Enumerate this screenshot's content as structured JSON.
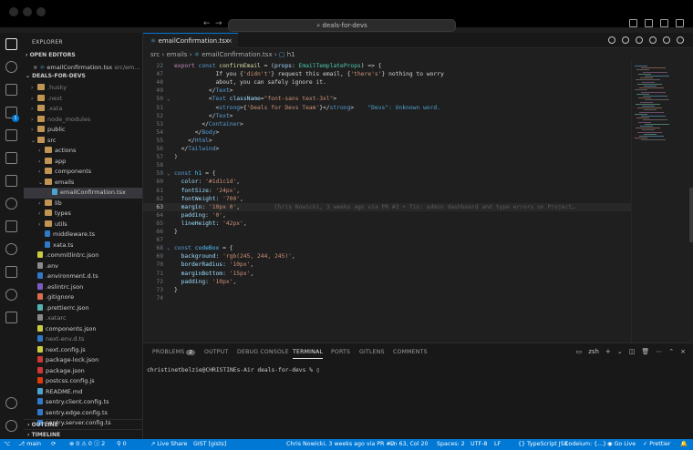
{
  "titlebar": {
    "search": "deals-for-devs"
  },
  "sidebar": {
    "title": "EXPLORER",
    "open_editors_label": "OPEN EDITORS",
    "open_editor_file": "emailConfirmation.tsx",
    "open_editor_path": "src/em...",
    "project_label": "DEALS-FOR-DEVS",
    "tree": [
      {
        "label": ".husky",
        "depth": 1,
        "chev": "›",
        "color": "#7d7d7d",
        "kind": "folder"
      },
      {
        "label": ".next",
        "depth": 1,
        "chev": "›",
        "color": "#7d7d7d",
        "kind": "folder"
      },
      {
        "label": ".xata",
        "depth": 1,
        "chev": "›",
        "color": "#7d7d7d",
        "kind": "folder"
      },
      {
        "label": "node_modules",
        "depth": 1,
        "chev": "›",
        "color": "#7d7d7d",
        "kind": "folder"
      },
      {
        "label": "public",
        "depth": 1,
        "chev": "›",
        "color": "#cccccc",
        "kind": "folder"
      },
      {
        "label": "src",
        "depth": 1,
        "chev": "⌄",
        "color": "#cccccc",
        "kind": "folder"
      },
      {
        "label": "actions",
        "depth": 2,
        "chev": "›",
        "color": "#cccccc",
        "kind": "folder"
      },
      {
        "label": "app",
        "depth": 2,
        "chev": "›",
        "color": "#cccccc",
        "kind": "folder"
      },
      {
        "label": "components",
        "depth": 2,
        "chev": "›",
        "color": "#cccccc",
        "kind": "folder"
      },
      {
        "label": "emails",
        "depth": 2,
        "chev": "⌄",
        "color": "#cccccc",
        "kind": "folder"
      },
      {
        "label": "emailConfirmation.tsx",
        "depth": 3,
        "chev": "",
        "color": "#cccccc",
        "kind": "tsx",
        "selected": true
      },
      {
        "label": "lib",
        "depth": 2,
        "chev": "›",
        "color": "#cccccc",
        "kind": "folder"
      },
      {
        "label": "types",
        "depth": 2,
        "chev": "›",
        "color": "#cccccc",
        "kind": "folder"
      },
      {
        "label": "utils",
        "depth": 2,
        "chev": "›",
        "color": "#cccccc",
        "kind": "folder"
      },
      {
        "label": "middleware.ts",
        "depth": 2,
        "chev": "",
        "color": "#cccccc",
        "kind": "ts"
      },
      {
        "label": "xata.ts",
        "depth": 2,
        "chev": "",
        "color": "#cccccc",
        "kind": "ts"
      },
      {
        "label": ".commitlintrc.json",
        "depth": 1,
        "chev": "",
        "color": "#cccccc",
        "kind": "json"
      },
      {
        "label": ".env",
        "depth": 1,
        "chev": "",
        "color": "#cccccc",
        "kind": "gear"
      },
      {
        "label": ".environment.d.ts",
        "depth": 1,
        "chev": "",
        "color": "#cccccc",
        "kind": "ts"
      },
      {
        "label": ".eslintrc.json",
        "depth": 1,
        "chev": "",
        "color": "#cccccc",
        "kind": "eslint"
      },
      {
        "label": ".gitignore",
        "depth": 1,
        "chev": "",
        "color": "#cccccc",
        "kind": "git"
      },
      {
        "label": ".prettierrc.json",
        "depth": 1,
        "chev": "",
        "color": "#cccccc",
        "kind": "prettier"
      },
      {
        "label": ".xatarc",
        "depth": 1,
        "chev": "",
        "color": "#8a8a8a",
        "kind": "plain"
      },
      {
        "label": "components.json",
        "depth": 1,
        "chev": "",
        "color": "#cccccc",
        "kind": "json"
      },
      {
        "label": "next-env.d.ts",
        "depth": 1,
        "chev": "",
        "color": "#8a8a8a",
        "kind": "ts"
      },
      {
        "label": "next.config.js",
        "depth": 1,
        "chev": "",
        "color": "#cccccc",
        "kind": "js"
      },
      {
        "label": "package-lock.json",
        "depth": 1,
        "chev": "",
        "color": "#cccccc",
        "kind": "npm"
      },
      {
        "label": "package.json",
        "depth": 1,
        "chev": "",
        "color": "#cccccc",
        "kind": "npm"
      },
      {
        "label": "postcss.config.js",
        "depth": 1,
        "chev": "",
        "color": "#cccccc",
        "kind": "postcss"
      },
      {
        "label": "README.md",
        "depth": 1,
        "chev": "",
        "color": "#cccccc",
        "kind": "md"
      },
      {
        "label": "sentry.client.config.ts",
        "depth": 1,
        "chev": "",
        "color": "#cccccc",
        "kind": "ts"
      },
      {
        "label": "sentry.edge.config.ts",
        "depth": 1,
        "chev": "",
        "color": "#cccccc",
        "kind": "ts"
      },
      {
        "label": "sentry.server.config.ts",
        "depth": 1,
        "chev": "",
        "color": "#cccccc",
        "kind": "ts"
      }
    ],
    "outline_label": "OUTLINE",
    "timeline_label": "TIMELINE"
  },
  "editor": {
    "tab_label": "emailConfirmation.tsx",
    "breadcrumb": [
      "src",
      "emails",
      "emailConfirmation.tsx",
      "h1"
    ],
    "blame_text": "Chris Nowicki, 3 weeks ago via PR #2 • fix: admin dashboard and type errors on Project…",
    "lines": [
      {
        "n": "22",
        "fold": "",
        "segs": [
          [
            "k",
            "export "
          ],
          [
            "kb",
            "const "
          ],
          [
            "fn",
            "confirmEmail"
          ],
          [
            "pu",
            " = ("
          ],
          [
            "pr",
            "props"
          ],
          [
            "pu",
            ": "
          ],
          [
            "ty",
            "EmailTemplateProps"
          ],
          [
            "pu",
            ") => {"
          ]
        ]
      },
      {
        "n": "47",
        "fold": "",
        "segs": [
          [
            "pu",
            "            If you {"
          ],
          [
            "s",
            "'didn't'"
          ],
          [
            "pu",
            "} request this email, {"
          ],
          [
            "s",
            "'there's'"
          ],
          [
            "pu",
            "} nothing to worry"
          ]
        ]
      },
      {
        "n": "48",
        "fold": "",
        "segs": [
          [
            "pu",
            "            about, you can safely ignore it."
          ]
        ]
      },
      {
        "n": "49",
        "fold": "",
        "segs": [
          [
            "pu",
            "          </"
          ],
          [
            "tg",
            "Text"
          ],
          [
            "pu",
            ">"
          ]
        ]
      },
      {
        "n": "50",
        "fold": "⌄",
        "segs": [
          [
            "pu",
            "          <"
          ],
          [
            "tg",
            "Text "
          ],
          [
            "at",
            "className"
          ],
          [
            "pu",
            "="
          ],
          [
            "s",
            "\"font-sans text-3xl\""
          ],
          [
            "pu",
            ">"
          ]
        ]
      },
      {
        "n": "51",
        "fold": "",
        "segs": [
          [
            "pu",
            "            <"
          ],
          [
            "tg",
            "strong"
          ],
          [
            "pu",
            ">{"
          ],
          [
            "s",
            "'Deals for Devs Team'"
          ],
          [
            "pu",
            "}</"
          ],
          [
            "tg",
            "strong"
          ],
          [
            "pu",
            ">"
          ]
        ],
        "warn": "    \"Devs\": Unknown word."
      },
      {
        "n": "52",
        "fold": "",
        "segs": [
          [
            "pu",
            "          </"
          ],
          [
            "tg",
            "Text"
          ],
          [
            "pu",
            ">"
          ]
        ]
      },
      {
        "n": "53",
        "fold": "",
        "segs": [
          [
            "pu",
            "        </"
          ],
          [
            "tg",
            "Container"
          ],
          [
            "pu",
            ">"
          ]
        ]
      },
      {
        "n": "54",
        "fold": "",
        "segs": [
          [
            "pu",
            "      </"
          ],
          [
            "tg",
            "Body"
          ],
          [
            "pu",
            ">"
          ]
        ]
      },
      {
        "n": "55",
        "fold": "",
        "segs": [
          [
            "pu",
            "    </"
          ],
          [
            "tg",
            "Html"
          ],
          [
            "pu",
            ">"
          ]
        ]
      },
      {
        "n": "56",
        "fold": "",
        "segs": [
          [
            "pu",
            "  </"
          ],
          [
            "tg",
            "Tailwind"
          ],
          [
            "pu",
            ">"
          ]
        ]
      },
      {
        "n": "57",
        "fold": "",
        "segs": [
          [
            "pu",
            ")"
          ]
        ]
      },
      {
        "n": "58",
        "fold": "",
        "segs": []
      },
      {
        "n": "59",
        "fold": "⌄",
        "segs": [
          [
            "kb",
            "const "
          ],
          [
            "v",
            "h1"
          ],
          [
            "pu",
            " = {"
          ]
        ]
      },
      {
        "n": "60",
        "fold": "",
        "segs": [
          [
            "pr",
            "  color"
          ],
          [
            "pu",
            ": "
          ],
          [
            "s",
            "'#1d1c1d'"
          ],
          [
            "pu",
            ","
          ]
        ]
      },
      {
        "n": "61",
        "fold": "",
        "segs": [
          [
            "pr",
            "  fontSize"
          ],
          [
            "pu",
            ": "
          ],
          [
            "s",
            "'24px'"
          ],
          [
            "pu",
            ","
          ]
        ]
      },
      {
        "n": "62",
        "fold": "",
        "segs": [
          [
            "pr",
            "  fontWeight"
          ],
          [
            "pu",
            ": "
          ],
          [
            "s",
            "'700'"
          ],
          [
            "pu",
            ","
          ]
        ]
      },
      {
        "n": "63",
        "fold": "",
        "cur": true,
        "segs": [
          [
            "pr",
            "  margin"
          ],
          [
            "pu",
            ": "
          ],
          [
            "s",
            "'10px 0'"
          ],
          [
            "pu",
            ","
          ]
        ]
      },
      {
        "n": "64",
        "fold": "",
        "segs": [
          [
            "pr",
            "  padding"
          ],
          [
            "pu",
            ": "
          ],
          [
            "s",
            "'0'"
          ],
          [
            "pu",
            ","
          ]
        ]
      },
      {
        "n": "65",
        "fold": "",
        "segs": [
          [
            "pr",
            "  lineHeight"
          ],
          [
            "pu",
            ": "
          ],
          [
            "s",
            "'42px'"
          ],
          [
            "pu",
            ","
          ]
        ]
      },
      {
        "n": "66",
        "fold": "",
        "segs": [
          [
            "pu",
            "}"
          ]
        ]
      },
      {
        "n": "67",
        "fold": "",
        "segs": []
      },
      {
        "n": "68",
        "fold": "⌄",
        "segs": [
          [
            "kb",
            "const "
          ],
          [
            "v",
            "codeBox"
          ],
          [
            "pu",
            " = {"
          ]
        ]
      },
      {
        "n": "69",
        "fold": "",
        "segs": [
          [
            "pr",
            "  background"
          ],
          [
            "pu",
            ": "
          ],
          [
            "s",
            "'rgb(245, 244, 245)'"
          ],
          [
            "pu",
            ","
          ]
        ]
      },
      {
        "n": "70",
        "fold": "",
        "segs": [
          [
            "pr",
            "  borderRadius"
          ],
          [
            "pu",
            ": "
          ],
          [
            "s",
            "'10px'"
          ],
          [
            "pu",
            ","
          ]
        ]
      },
      {
        "n": "71",
        "fold": "",
        "segs": [
          [
            "pr",
            "  marginBottom"
          ],
          [
            "pu",
            ": "
          ],
          [
            "s",
            "'15px'"
          ],
          [
            "pu",
            ","
          ]
        ]
      },
      {
        "n": "72",
        "fold": "",
        "segs": [
          [
            "pr",
            "  padding"
          ],
          [
            "pu",
            ": "
          ],
          [
            "s",
            "'10px'"
          ],
          [
            "pu",
            ","
          ]
        ]
      },
      {
        "n": "73",
        "fold": "",
        "segs": [
          [
            "pu",
            "}"
          ]
        ]
      },
      {
        "n": "74",
        "fold": "",
        "segs": []
      }
    ]
  },
  "panel": {
    "tabs": [
      {
        "label": "PROBLEMS",
        "badge": "2"
      },
      {
        "label": "OUTPUT"
      },
      {
        "label": "DEBUG CONSOLE"
      },
      {
        "label": "TERMINAL",
        "active": true
      },
      {
        "label": "PORTS"
      },
      {
        "label": "GITLENS"
      },
      {
        "label": "COMMENTS"
      }
    ],
    "shell": "zsh",
    "prompt": "christinetbelzie@CHRISTINEs-Air deals-for-devs % ▯"
  },
  "statusbar": {
    "branch": "main",
    "sync": "⟳",
    "problems": "⊗ 0 ⚠ 0 ⓘ 2",
    "ports": "⚲ 0",
    "live_share": "Live Share",
    "gist": "GIST [gists]",
    "blame": "Chris Nowicki, 3 weeks ago via PR #2",
    "position": "Ln 63, Col 20",
    "spaces": "Spaces: 2",
    "encoding": "UTF-8",
    "eol": "LF",
    "language": "{} TypeScript JSX",
    "codeium": "Codeium: {...}",
    "go_live": "Go Live",
    "prettier": "✓ Prettier"
  }
}
